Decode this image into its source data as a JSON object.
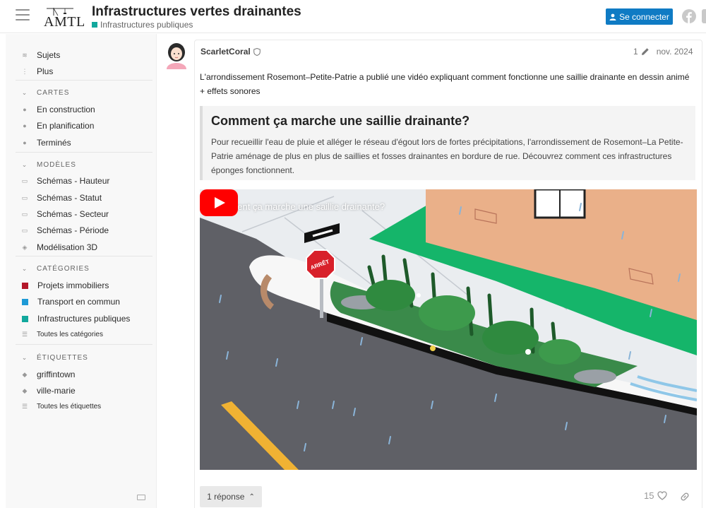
{
  "header": {
    "logo_text": "AMTL",
    "title": "Infrastructures vertes drainantes",
    "category": "Infrastructures publiques",
    "category_color": "#12a89d",
    "login_label": "Se connecter",
    "login_color": "#0f7bc4"
  },
  "sidebar": {
    "top_items": [
      {
        "label": "Sujets",
        "icon": "layers-icon"
      },
      {
        "label": "Plus",
        "icon": "more-icon"
      }
    ],
    "sections": [
      {
        "title": "CARTES",
        "items": [
          "En construction",
          "En planification",
          "Terminés"
        ]
      },
      {
        "title": "MODÈLES",
        "items": [
          "Schémas - Hauteur",
          "Schémas - Statut",
          "Schémas - Secteur",
          "Schémas - Période",
          "Modélisation 3D"
        ]
      },
      {
        "title": "CATÉGORIES",
        "items": [
          "Projets immobiliers",
          "Transport en commun",
          "Infrastructures publiques",
          "Toutes les catégories"
        ]
      },
      {
        "title": "ÉTIQUETTES",
        "items": [
          "griffintown",
          "ville-marie",
          "Toutes les étiquettes"
        ]
      }
    ],
    "category_colors": [
      "#b3182a",
      "#1e9ad6",
      "#12a89d"
    ]
  },
  "post": {
    "username": "ScarletCoral",
    "edit_count": "1",
    "date": "nov. 2024",
    "body": "L'arrondissement Rosemont–Petite-Patrie a publié une vidéo expliquant comment fonctionne une saillie drainante en dessin animé + effets sonores",
    "onebox": {
      "title": "Comment ça marche une saillie drainante?",
      "description": "Pour recueillir l'eau de pluie et alléger le réseau d'égout lors de fortes précipitations, l'arrondissement de Rosemont–La Petite-Patrie aménage de plus en plus de saillies et fosses drainantes en bordure de rue. Découvrez comment ces infrastructures éponges fonctionnent."
    },
    "video": {
      "title": "Comment ça marche une saillie drainante?",
      "sign_text": "ARRÊT"
    },
    "reply_label": "1 réponse",
    "likes": "15"
  }
}
